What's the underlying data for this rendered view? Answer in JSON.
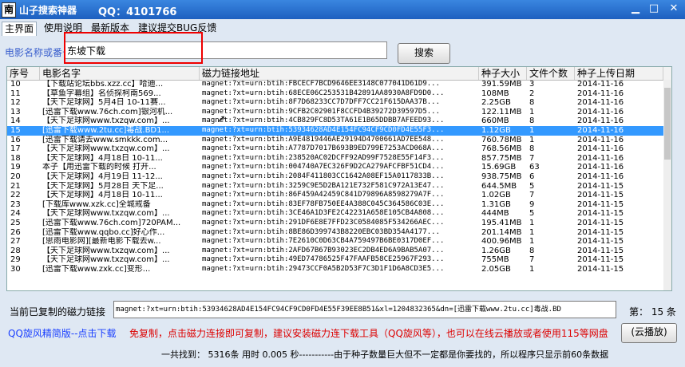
{
  "window": {
    "icon_glyph": "南",
    "title": "山子搜索神器",
    "qq": "QQ：4101766",
    "min_glyph": "▁",
    "max_glyph": "□",
    "close_glyph": "✕"
  },
  "tabs": [
    "主界面",
    "使用说明",
    "最新版本",
    "建议提交BUG反馈"
  ],
  "search": {
    "label": "电影名称或番号：",
    "value": "东坡下载",
    "button": "搜索"
  },
  "table": {
    "columns": [
      "序号",
      "电影名字",
      "磁力链接地址",
      "种子大小",
      "文件个数",
      "种子上传日期"
    ],
    "selected_index": 5,
    "rows": [
      [
        "10",
        "【下载站论坛bbs.xzz.cc】哈迪...",
        "magnet:?xt=urn:btih:FBCECF7BCD9646EE3148C077041D61D9...",
        "391.59MB",
        "3",
        "2014-11-16"
      ],
      [
        "11",
        "【草鱼字幕组】名侦探柯南569...",
        "magnet:?xt=urn:btih:68ECE06C253531B42891AA8930A8FD9D0...",
        "108MB",
        "2",
        "2014-11-16"
      ],
      [
        "12",
        "【天下足球网】5月4日 10-11赛...",
        "magnet:?xt=urn:btih:8F7D68233CC7D7DFF7CC21F615DAA37B...",
        "2.25GB",
        "8",
        "2014-11-16"
      ],
      [
        "13",
        "[迅雷下载www.76ch.com]银河机...",
        "magnet:?xt=urn:btih:9CFB2C02901F8CCFD4B39272D39597D5...",
        "122.11MB",
        "1",
        "2014-11-16"
      ],
      [
        "14",
        "【天下足球网www.txzqw.com】...",
        "magnet:?xt=urn:btih:4CB829FC8D53TA61E1B65DDBB7AFEED93...",
        "660MB",
        "8",
        "2014-11-16"
      ],
      [
        "15",
        "[迅雷下载www.2tu.cc]毒战.BD1...",
        "magnet:?xt=urn:btih:53934628AD4E154FC94CF9CD0FD4E55F3...",
        "1.12GB",
        "1",
        "2014-11-16"
      ],
      [
        "16",
        "[迅雷下载请去www.smkkk.com...",
        "magnet:?xt=urn:btih:A9E4819446AE29194D4700661AD7EE548...",
        "760.78MB",
        "1",
        "2014-11-16"
      ],
      [
        "17",
        "【天下足球网www.txzqw.com】...",
        "magnet:?xt=urn:btih:A7787D7017B693B9ED799E7253ACD068A...",
        "768.56MB",
        "8",
        "2014-11-16"
      ],
      [
        "18",
        "【天下足球网】4月18日 10-11...",
        "magnet:?xt=urn:btih:238520AC02DCFF92AD99F7528E55F14F3...",
        "857.75MB",
        "7",
        "2014-11-16"
      ],
      [
        "19",
        "本子【用迅雷下载的时候 打开...",
        "magnet:?xt=urn:btih:004740A7EC326F9D2CA279AFCFBF51CD4...",
        "15.69GB",
        "63",
        "2014-11-16"
      ],
      [
        "20",
        "【天下足球网】4月19日 11-12...",
        "magnet:?xt=urn:btih:2084F411803CC1642A08EF15A0117833B...",
        "938.75MB",
        "6",
        "2014-11-16"
      ],
      [
        "21",
        "【天下足球网】5月28日 天下足...",
        "magnet:?xt=urn:btih:3259C9E5D2BA121E732F581C972A13E47...",
        "644.5MB",
        "5",
        "2014-11-15"
      ],
      [
        "22",
        "【天下足球网】4月18日 10-11...",
        "magnet:?xt=urn:btih:86F459A42459C841D79896A8598279A7F...",
        "1.02GB",
        "7",
        "2014-11-15"
      ],
      [
        "23",
        "[下载库www.xzk.cc]全城戒备",
        "magnet:?xt=urn:btih:83EF78FB750EE4A388C045C364586C03E...",
        "1.31GB",
        "9",
        "2014-11-15"
      ],
      [
        "24",
        "【天下足球网www.txzqw.com】...",
        "magnet:?xt=urn:btih:3CE46A1D3FE2C42231A658E105CB4A808...",
        "444MB",
        "5",
        "2014-11-15"
      ],
      [
        "25",
        "[迅雷下载www.76ch.com]720PAM...",
        "magnet:?xt=urn:btih:291DF6E8E7FFD23C0584085F534266AEC...",
        "195.41MB",
        "1",
        "2014-11-15"
      ],
      [
        "26",
        "[迅雷下载www.qqbo.cc]好心作...",
        "magnet:?xt=urn:btih:8BE86D399743B8220EBC03BD354A4177...",
        "201.14MB",
        "1",
        "2014-11-15"
      ],
      [
        "27",
        "[思雨电影网][最新电影下载去w...",
        "magnet:?xt=urn:btih:7E2610C0D63CB4A759497B6BE0317D0EF...",
        "400.96MB",
        "1",
        "2014-11-15"
      ],
      [
        "28",
        "【天下足球网www.txzqw.com】...",
        "magnet:?xt=urn:btih:2AFD67B67B93023EC2DB4ED6A9BAB5A07...",
        "1.26GB",
        "8",
        "2014-11-15"
      ],
      [
        "29",
        "【天下足球网www.txzqw.com】...",
        "magnet:?xt=urn:btih:49ED74786525F47FAAFB58CE25967F293...",
        "755MB",
        "7",
        "2014-11-15"
      ],
      [
        "30",
        "[迅雷下载www.zxk.cc]变形...",
        "magnet:?xt=urn:btih:29473CCF0A5B2D53F7C3D1F1D6A8CD3E5...",
        "2.05GB",
        "1",
        "2014-11-15"
      ]
    ]
  },
  "footer": {
    "copy_label": "当前已复制的磁力链接",
    "copy_value": "magnet:?xt=urn:btih:53934628AD4E154FC94CF9CD0FD4E55F39EE8B51&xl=1204832365&dn=[迅雷下载www.2tu.cc]毒战.BD",
    "index_label": "第：  15 条",
    "qq_link": "QQ旋风精简版--点击下载",
    "notice": "免复制，点击磁力连接即可复制，建议安装磁力连下载工具（QQ旋风等），也可以在线云播放或者使用115等网盘",
    "play_button": "(云播放)",
    "status": "一共找到：  5316条    用时 0.005 秒-----------由于种子数量巨大但不一定都是你要找的，所以程序只显示前60条数据"
  }
}
